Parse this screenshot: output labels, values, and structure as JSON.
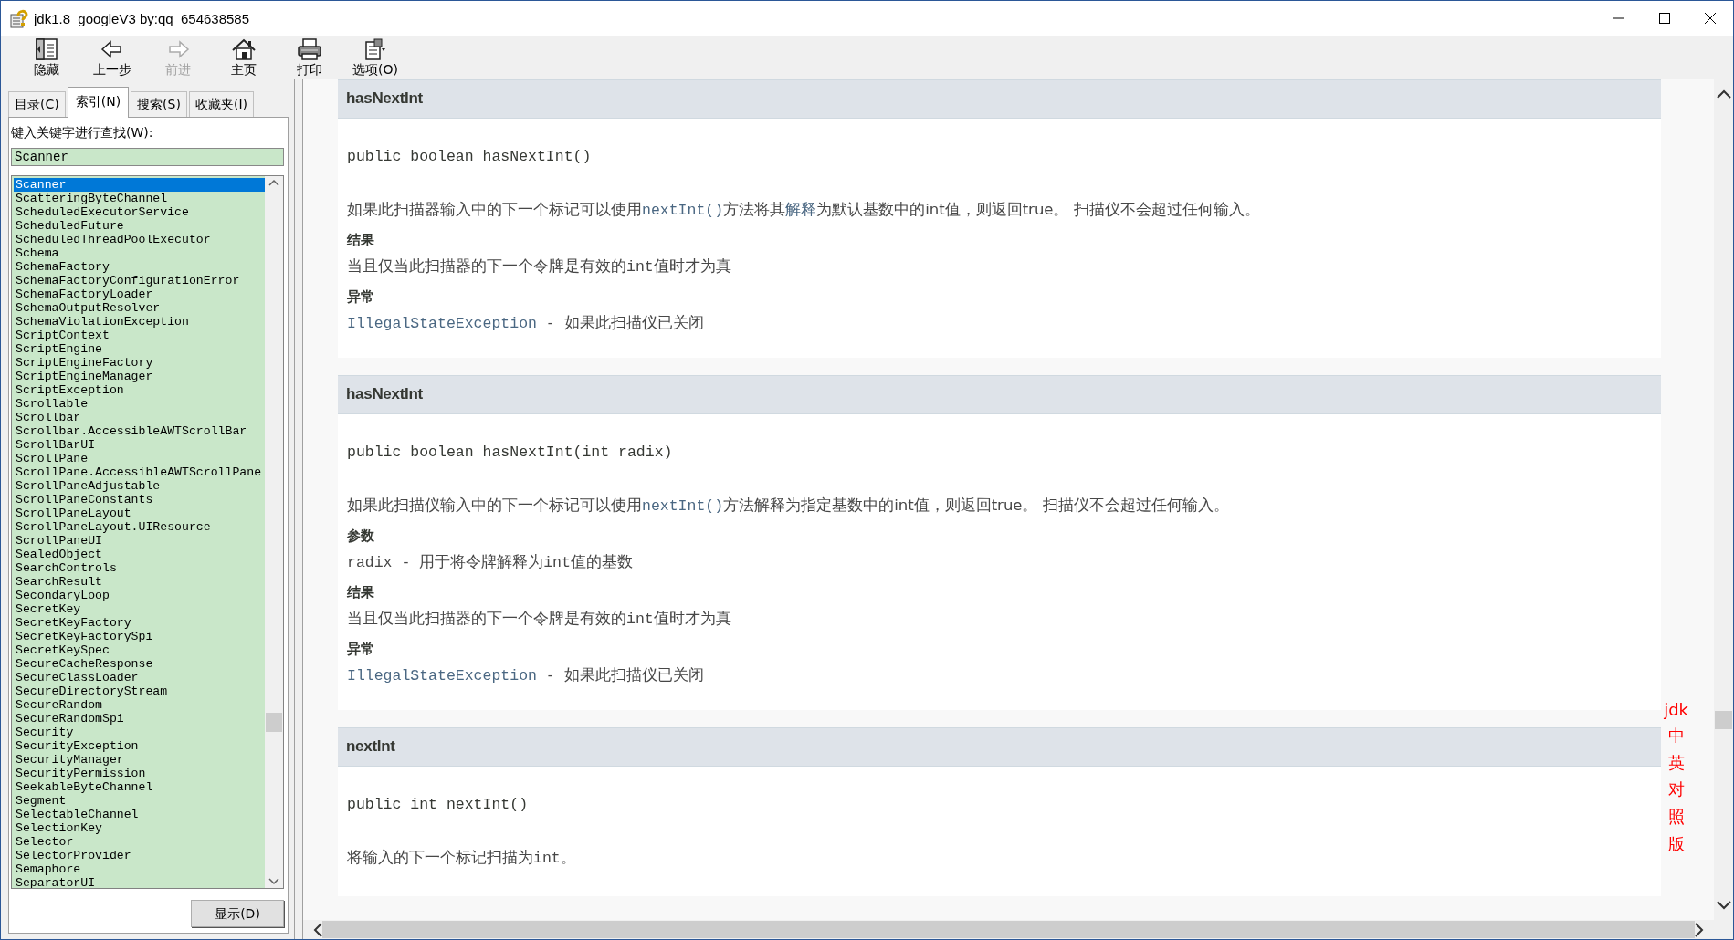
{
  "window": {
    "title": "jdk1.8_googleV3 by:qq_654638585"
  },
  "toolbar": [
    {
      "label": "隐藏",
      "kind": "hide",
      "disabled": false
    },
    {
      "label": "上一步",
      "kind": "back",
      "disabled": false
    },
    {
      "label": "前进",
      "kind": "forward",
      "disabled": true
    },
    {
      "label": "主页",
      "kind": "home",
      "disabled": false
    },
    {
      "label": "打印",
      "kind": "print",
      "disabled": false
    },
    {
      "label": "选项(O)",
      "kind": "options",
      "disabled": false
    }
  ],
  "tabs": [
    {
      "label": "目录(C)",
      "selected": false
    },
    {
      "label": "索引(N)",
      "selected": true
    },
    {
      "label": "搜索(S)",
      "selected": false
    },
    {
      "label": "收藏夹(I)",
      "selected": false
    }
  ],
  "index": {
    "prompt": "键入关键字进行查找(W):",
    "search_value": "Scanner",
    "items": [
      {
        "label": "Scanner",
        "selected": true
      },
      {
        "label": "ScatteringByteChannel",
        "selected": false
      },
      {
        "label": "ScheduledExecutorService",
        "selected": false
      },
      {
        "label": "ScheduledFuture",
        "selected": false
      },
      {
        "label": "ScheduledThreadPoolExecutor",
        "selected": false
      },
      {
        "label": "Schema",
        "selected": false
      },
      {
        "label": "SchemaFactory",
        "selected": false
      },
      {
        "label": "SchemaFactoryConfigurationError",
        "selected": false
      },
      {
        "label": "SchemaFactoryLoader",
        "selected": false
      },
      {
        "label": "SchemaOutputResolver",
        "selected": false
      },
      {
        "label": "SchemaViolationException",
        "selected": false
      },
      {
        "label": "ScriptContext",
        "selected": false
      },
      {
        "label": "ScriptEngine",
        "selected": false
      },
      {
        "label": "ScriptEngineFactory",
        "selected": false
      },
      {
        "label": "ScriptEngineManager",
        "selected": false
      },
      {
        "label": "ScriptException",
        "selected": false
      },
      {
        "label": "Scrollable",
        "selected": false
      },
      {
        "label": "Scrollbar",
        "selected": false
      },
      {
        "label": "Scrollbar.AccessibleAWTScrollBar",
        "selected": false
      },
      {
        "label": "ScrollBarUI",
        "selected": false
      },
      {
        "label": "ScrollPane",
        "selected": false
      },
      {
        "label": "ScrollPane.AccessibleAWTScrollPane",
        "selected": false
      },
      {
        "label": "ScrollPaneAdjustable",
        "selected": false
      },
      {
        "label": "ScrollPaneConstants",
        "selected": false
      },
      {
        "label": "ScrollPaneLayout",
        "selected": false
      },
      {
        "label": "ScrollPaneLayout.UIResource",
        "selected": false
      },
      {
        "label": "ScrollPaneUI",
        "selected": false
      },
      {
        "label": "SealedObject",
        "selected": false
      },
      {
        "label": "SearchControls",
        "selected": false
      },
      {
        "label": "SearchResult",
        "selected": false
      },
      {
        "label": "SecondaryLoop",
        "selected": false
      },
      {
        "label": "SecretKey",
        "selected": false
      },
      {
        "label": "SecretKeyFactory",
        "selected": false
      },
      {
        "label": "SecretKeyFactorySpi",
        "selected": false
      },
      {
        "label": "SecretKeySpec",
        "selected": false
      },
      {
        "label": "SecureCacheResponse",
        "selected": false
      },
      {
        "label": "SecureClassLoader",
        "selected": false
      },
      {
        "label": "SecureDirectoryStream",
        "selected": false
      },
      {
        "label": "SecureRandom",
        "selected": false
      },
      {
        "label": "SecureRandomSpi",
        "selected": false
      },
      {
        "label": "Security",
        "selected": false
      },
      {
        "label": "SecurityException",
        "selected": false
      },
      {
        "label": "SecurityManager",
        "selected": false
      },
      {
        "label": "SecurityPermission",
        "selected": false
      },
      {
        "label": "SeekableByteChannel",
        "selected": false
      },
      {
        "label": "Segment",
        "selected": false
      },
      {
        "label": "SelectableChannel",
        "selected": false
      },
      {
        "label": "SelectionKey",
        "selected": false
      },
      {
        "label": "Selector",
        "selected": false
      },
      {
        "label": "SelectorProvider",
        "selected": false
      },
      {
        "label": "Semaphore",
        "selected": false
      },
      {
        "label": "SeparatorUI",
        "selected": false
      }
    ],
    "display_button": "显示(D)"
  },
  "sections": [
    {
      "title": "hasNextInt",
      "signature": "public boolean hasNextInt()",
      "description": [
        {
          "kind": "text",
          "text": "如果此扫描器输入中的下一个标记可以使用"
        },
        {
          "kind": "code-link",
          "text": "nextInt()"
        },
        {
          "kind": "text",
          "text": "方法将其"
        },
        {
          "kind": "link",
          "text": "解释"
        },
        {
          "kind": "text",
          "text": "为默认基数中的int值，则返回true。 扫描仪不会超过任何输入。"
        }
      ],
      "blocks": [
        {
          "heading": "结果",
          "body": [
            {
              "kind": "text",
              "text": "当且仅当此扫描器的下一个令牌是有效的"
            },
            {
              "kind": "code",
              "text": "int"
            },
            {
              "kind": "text",
              "text": "值时才为真"
            }
          ]
        },
        {
          "heading": "异常",
          "body": [
            {
              "kind": "code-link",
              "text": "IllegalStateException"
            },
            {
              "kind": "code",
              "text": " - "
            },
            {
              "kind": "text",
              "text": "如果此扫描仪已关闭"
            }
          ]
        }
      ]
    },
    {
      "title": "hasNextInt",
      "signature": "public boolean hasNextInt(int radix)",
      "description": [
        {
          "kind": "text",
          "text": "如果此扫描仪输入中的下一个标记可以使用"
        },
        {
          "kind": "code-link",
          "text": "nextInt()"
        },
        {
          "kind": "text",
          "text": "方法解释为指定基数中的int值，则返回true。 扫描仪不会超过任何输入。"
        }
      ],
      "blocks": [
        {
          "heading": "参数",
          "body": [
            {
              "kind": "code",
              "text": "radix - "
            },
            {
              "kind": "text",
              "text": "用于将令牌解释为"
            },
            {
              "kind": "code",
              "text": "int"
            },
            {
              "kind": "text",
              "text": "值的基数"
            }
          ]
        },
        {
          "heading": "结果",
          "body": [
            {
              "kind": "text",
              "text": "当且仅当此扫描器的下一个令牌是有效的"
            },
            {
              "kind": "code",
              "text": "int"
            },
            {
              "kind": "text",
              "text": "值时才为真"
            }
          ]
        },
        {
          "heading": "异常",
          "body": [
            {
              "kind": "code-link",
              "text": "IllegalStateException"
            },
            {
              "kind": "code",
              "text": " - "
            },
            {
              "kind": "text",
              "text": "如果此扫描仪已关闭"
            }
          ]
        }
      ]
    },
    {
      "title": "nextInt",
      "signature": "public int nextInt()",
      "description": [
        {
          "kind": "text",
          "text": "将输入的下一个标记扫描为"
        },
        {
          "kind": "code",
          "text": "int"
        },
        {
          "kind": "text",
          "text": "。"
        }
      ]
    }
  ],
  "side_label": {
    "latin": "jdk",
    "cjk": "中英对照版"
  }
}
